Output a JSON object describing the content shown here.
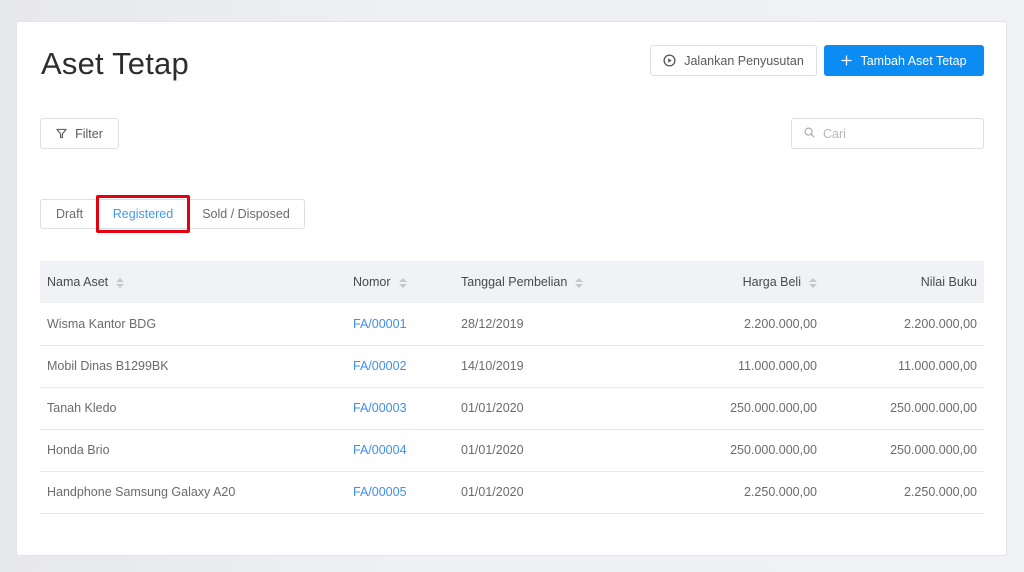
{
  "page": {
    "title": "Aset Tetap"
  },
  "toolbar": {
    "run_depreciation_label": "Jalankan Penyusutan",
    "add_asset_label": "Tambah Aset Tetap",
    "filter_label": "Filter",
    "search_placeholder": "Cari",
    "primary_color": "#0b8cf2"
  },
  "tabs": [
    {
      "label": "Draft",
      "active": false
    },
    {
      "label": "Registered",
      "active": true
    },
    {
      "label": "Sold / Disposed",
      "active": false
    }
  ],
  "table": {
    "columns": [
      {
        "label": "Nama Aset",
        "sortable": true
      },
      {
        "label": "Nomor",
        "sortable": true
      },
      {
        "label": "Tanggal Pembelian",
        "sortable": true
      },
      {
        "label": "Harga Beli",
        "sortable": true
      },
      {
        "label": "Nilai Buku",
        "sortable": false
      }
    ],
    "rows": [
      {
        "name": "Wisma Kantor BDG",
        "number": "FA/00001",
        "date": "28/12/2019",
        "price": "2.200.000,00",
        "book_value": "2.200.000,00"
      },
      {
        "name": "Mobil Dinas B1299BK",
        "number": "FA/00002",
        "date": "14/10/2019",
        "price": "11.000.000,00",
        "book_value": "11.000.000,00"
      },
      {
        "name": "Tanah Kledo",
        "number": "FA/00003",
        "date": "01/01/2020",
        "price": "250.000.000,00",
        "book_value": "250.000.000,00"
      },
      {
        "name": "Honda Brio",
        "number": "FA/00004",
        "date": "01/01/2020",
        "price": "250.000.000,00",
        "book_value": "250.000.000,00"
      },
      {
        "name": "Handphone Samsung Galaxy A20",
        "number": "FA/00005",
        "date": "01/01/2020",
        "price": "2.250.000,00",
        "book_value": "2.250.000,00"
      }
    ]
  }
}
